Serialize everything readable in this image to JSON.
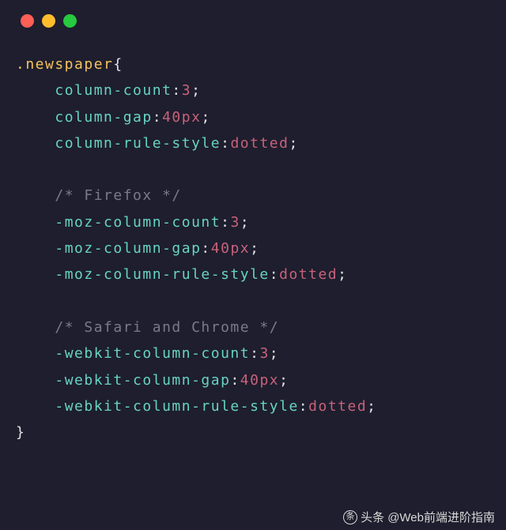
{
  "selector": ".newspaper",
  "openBrace": "{",
  "closeBrace": "}",
  "colon": ":",
  "semicolon": ";",
  "indent": "    ",
  "commentFirefox": "/* Firefox */",
  "commentSafariChrome": "/* Safari and Chrome */",
  "rules": {
    "standard": [
      {
        "prop": "column-count",
        "val": "3",
        "unit": ""
      },
      {
        "prop": "column-gap",
        "val": "40",
        "unit": "px"
      },
      {
        "prop": "column-rule-style",
        "val": "dotted",
        "unit": ""
      }
    ],
    "moz": [
      {
        "prop": "-moz-column-count",
        "val": "3",
        "unit": ""
      },
      {
        "prop": "-moz-column-gap",
        "val": "40",
        "unit": "px"
      },
      {
        "prop": "-moz-column-rule-style",
        "val": "dotted",
        "unit": ""
      }
    ],
    "webkit": [
      {
        "prop": "-webkit-column-count",
        "val": "3",
        "unit": ""
      },
      {
        "prop": "-webkit-column-gap",
        "val": "40",
        "unit": "px"
      },
      {
        "prop": "-webkit-column-rule-style",
        "val": "dotted",
        "unit": ""
      }
    ]
  },
  "watermark": {
    "label": "头条",
    "handle": "@Web前端进阶指南"
  }
}
